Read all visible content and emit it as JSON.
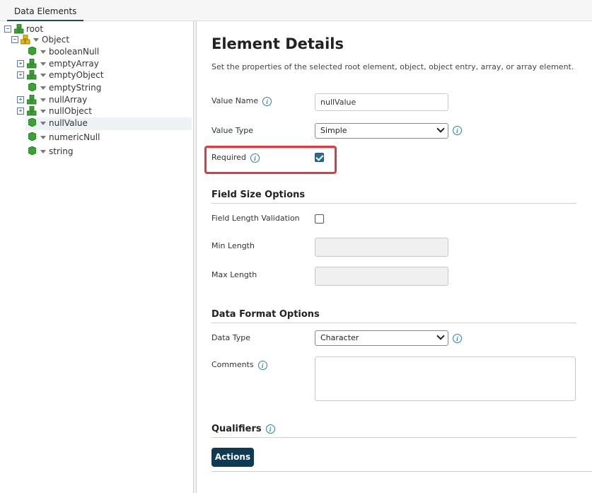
{
  "tabs": {
    "data_elements": "Data Elements"
  },
  "tree": {
    "root": "root",
    "object": "Object",
    "items": [
      "booleanNull",
      "emptyArray",
      "emptyObject",
      "emptyString",
      "nullArray",
      "nullObject",
      "nullValue",
      "numericNull",
      "string"
    ]
  },
  "details": {
    "title": "Element Details",
    "subtitle": "Set the properties of the selected root element, object, object entry, array, or array element.",
    "value_name_label": "Value Name",
    "value_name_value": "nullValue",
    "value_type_label": "Value Type",
    "value_type_value": "Simple",
    "required_label": "Required",
    "required_checked": true,
    "field_size_heading": "Field Size Options",
    "field_length_label": "Field Length Validation",
    "min_length_label": "Min Length",
    "max_length_label": "Max Length",
    "data_format_heading": "Data Format Options",
    "data_type_label": "Data Type",
    "data_type_value": "Character",
    "comments_label": "Comments",
    "qualifiers_heading": "Qualifiers",
    "actions_label": "Actions",
    "info_glyph": "i"
  },
  "colors": {
    "accent": "#0f3a56",
    "highlight": "#e0393e",
    "checkbox": "#2a6e8c",
    "cube_green": "#3aa335",
    "cube_yellow": "#e6b600"
  }
}
